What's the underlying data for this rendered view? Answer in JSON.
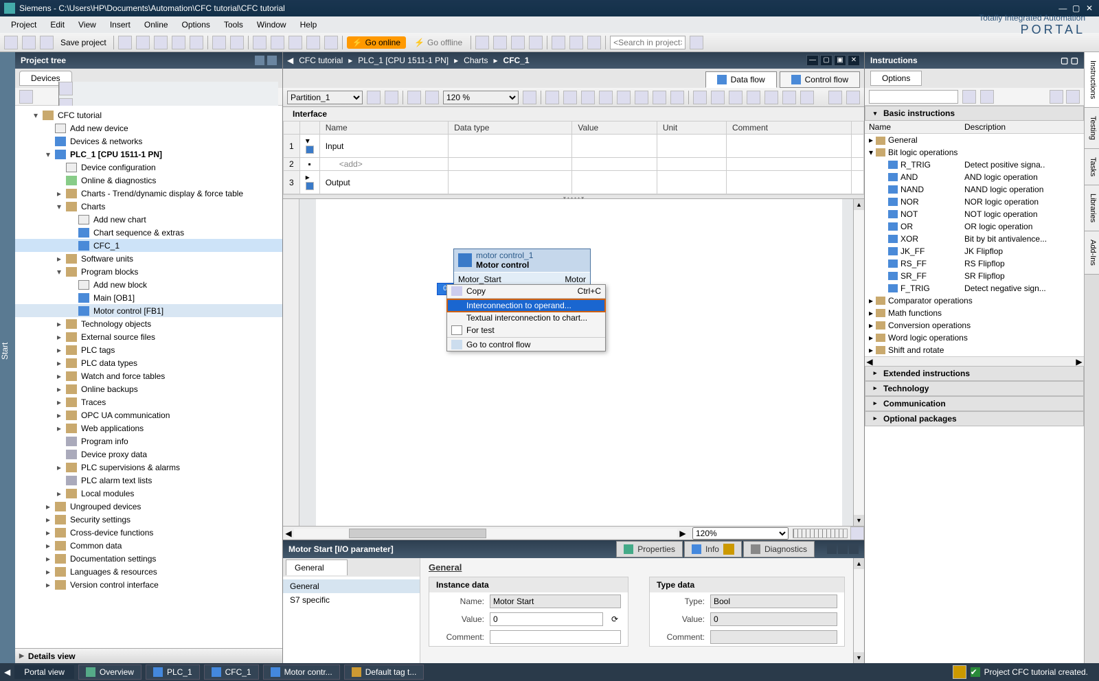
{
  "title": "Siemens  -  C:\\Users\\HP\\Documents\\Automation\\CFC tutorial\\CFC tutorial",
  "menubar": [
    "Project",
    "Edit",
    "View",
    "Insert",
    "Online",
    "Options",
    "Tools",
    "Window",
    "Help"
  ],
  "tia": {
    "line1": "Totally Integrated Automation",
    "line2": "PORTAL"
  },
  "toolbar": {
    "save": "Save project",
    "goOnline": "Go online",
    "goOffline": "Go offline",
    "searchPlaceholder": "<Search in project>"
  },
  "leftRail": "Start",
  "projectTree": {
    "title": "Project tree",
    "tab": "Devices",
    "details": "Details view",
    "nodes": [
      {
        "lvl": 1,
        "exp": "▾",
        "txt": "CFC tutorial",
        "ic": "ic"
      },
      {
        "lvl": 2,
        "exp": "",
        "txt": "Add new device",
        "ic": "ic white"
      },
      {
        "lvl": 2,
        "exp": "",
        "txt": "Devices & networks",
        "ic": "ic blue"
      },
      {
        "lvl": 2,
        "exp": "▾",
        "txt": "PLC_1 [CPU 1511-1 PN]",
        "ic": "ic blue",
        "bold": true
      },
      {
        "lvl": 3,
        "exp": "",
        "txt": "Device configuration",
        "ic": "ic white"
      },
      {
        "lvl": 3,
        "exp": "",
        "txt": "Online & diagnostics",
        "ic": "ic green"
      },
      {
        "lvl": 3,
        "exp": "▸",
        "txt": "Charts - Trend/dynamic display & force table",
        "ic": "ic"
      },
      {
        "lvl": 3,
        "exp": "▾",
        "txt": "Charts",
        "ic": "ic"
      },
      {
        "lvl": 4,
        "exp": "",
        "txt": "Add new chart",
        "ic": "ic white"
      },
      {
        "lvl": 4,
        "exp": "",
        "txt": "Chart sequence & extras",
        "ic": "ic blue"
      },
      {
        "lvl": 4,
        "exp": "",
        "txt": "CFC_1",
        "ic": "ic blue",
        "sel": true
      },
      {
        "lvl": 3,
        "exp": "▸",
        "txt": "Software units",
        "ic": "ic"
      },
      {
        "lvl": 3,
        "exp": "▾",
        "txt": "Program blocks",
        "ic": "ic"
      },
      {
        "lvl": 4,
        "exp": "",
        "txt": "Add new block",
        "ic": "ic white"
      },
      {
        "lvl": 4,
        "exp": "",
        "txt": "Main [OB1]",
        "ic": "ic blue"
      },
      {
        "lvl": 4,
        "exp": "",
        "txt": "Motor control [FB1]",
        "ic": "ic blue",
        "curr": true
      },
      {
        "lvl": 3,
        "exp": "▸",
        "txt": "Technology objects",
        "ic": "ic"
      },
      {
        "lvl": 3,
        "exp": "▸",
        "txt": "External source files",
        "ic": "ic"
      },
      {
        "lvl": 3,
        "exp": "▸",
        "txt": "PLC tags",
        "ic": "ic"
      },
      {
        "lvl": 3,
        "exp": "▸",
        "txt": "PLC data types",
        "ic": "ic"
      },
      {
        "lvl": 3,
        "exp": "▸",
        "txt": "Watch and force tables",
        "ic": "ic"
      },
      {
        "lvl": 3,
        "exp": "▸",
        "txt": "Online backups",
        "ic": "ic"
      },
      {
        "lvl": 3,
        "exp": "▸",
        "txt": "Traces",
        "ic": "ic"
      },
      {
        "lvl": 3,
        "exp": "▸",
        "txt": "OPC UA communication",
        "ic": "ic"
      },
      {
        "lvl": 3,
        "exp": "▸",
        "txt": "Web applications",
        "ic": "ic"
      },
      {
        "lvl": 3,
        "exp": "",
        "txt": "Program info",
        "ic": "ic grey"
      },
      {
        "lvl": 3,
        "exp": "",
        "txt": "Device proxy data",
        "ic": "ic grey"
      },
      {
        "lvl": 3,
        "exp": "▸",
        "txt": "PLC supervisions & alarms",
        "ic": "ic"
      },
      {
        "lvl": 3,
        "exp": "",
        "txt": "PLC alarm text lists",
        "ic": "ic grey"
      },
      {
        "lvl": 3,
        "exp": "▸",
        "txt": "Local modules",
        "ic": "ic"
      },
      {
        "lvl": 2,
        "exp": "▸",
        "txt": "Ungrouped devices",
        "ic": "ic"
      },
      {
        "lvl": 2,
        "exp": "▸",
        "txt": "Security settings",
        "ic": "ic"
      },
      {
        "lvl": 2,
        "exp": "▸",
        "txt": "Cross-device functions",
        "ic": "ic"
      },
      {
        "lvl": 2,
        "exp": "▸",
        "txt": "Common data",
        "ic": "ic"
      },
      {
        "lvl": 2,
        "exp": "▸",
        "txt": "Documentation settings",
        "ic": "ic"
      },
      {
        "lvl": 2,
        "exp": "▸",
        "txt": "Languages & resources",
        "ic": "ic"
      },
      {
        "lvl": 2,
        "exp": "▸",
        "txt": "Version control interface",
        "ic": "ic"
      }
    ]
  },
  "breadcrumb": [
    "CFC tutorial",
    "PLC_1 [CPU 1511-1 PN]",
    "Charts",
    "CFC_1"
  ],
  "flowTabs": {
    "data": "Data flow",
    "control": "Control flow"
  },
  "ctoolbar": {
    "partition": "Partition_1",
    "zoom": "120 %"
  },
  "interface": {
    "title": "Interface",
    "cols": [
      "",
      "Name",
      "Data type",
      "Value",
      "Unit",
      "Comment"
    ],
    "rows": [
      {
        "n": "1",
        "name": "Input",
        "kind": "hdr"
      },
      {
        "n": "2",
        "name": "<add>",
        "kind": "add"
      },
      {
        "n": "3",
        "name": "Output",
        "kind": "hdr"
      }
    ]
  },
  "block": {
    "instance": "motor control_1",
    "type": "Motor control",
    "port": "Motor_Start",
    "outPort": "Motor",
    "selPort": "0"
  },
  "ctx": {
    "copy": "Copy",
    "copyKey": "Ctrl+C",
    "interOp": "Interconnection to operand...",
    "interChart": "Textual interconnection to chart...",
    "forTest": "For test",
    "goCF": "Go to control flow"
  },
  "hzoom": "120%",
  "inspector": {
    "title": "Motor Start [I/O parameter]",
    "tabs": {
      "props": "Properties",
      "info": "Info",
      "diag": "Diagnostics"
    },
    "leftTab": "General",
    "leftItems": [
      "General",
      "S7 specific"
    ],
    "section": "General",
    "instance": {
      "title": "Instance data",
      "name": "Motor Start",
      "value": "0",
      "comment": "Comment:"
    },
    "type": {
      "title": "Type data",
      "type": "Bool",
      "value": "0",
      "comment": "Comment:"
    },
    "labels": {
      "name": "Name:",
      "value": "Value:",
      "type": "Type:"
    }
  },
  "right": {
    "title": "Instructions",
    "optsTab": "Options",
    "basic": "Basic instructions",
    "cols": {
      "name": "Name",
      "desc": "Description"
    },
    "cats": [
      {
        "txt": "General",
        "exp": "▸"
      },
      {
        "txt": "Bit logic operations",
        "exp": "▾",
        "items": [
          {
            "n": "R_TRIG",
            "d": "Detect positive signa.."
          },
          {
            "n": "AND",
            "d": "AND logic operation"
          },
          {
            "n": "NAND",
            "d": "NAND logic operation"
          },
          {
            "n": "NOR",
            "d": "NOR logic operation"
          },
          {
            "n": "NOT",
            "d": "NOT logic operation"
          },
          {
            "n": "OR",
            "d": "OR logic operation"
          },
          {
            "n": "XOR",
            "d": "Bit by bit antivalence..."
          },
          {
            "n": "JK_FF",
            "d": "JK Flipflop"
          },
          {
            "n": "RS_FF",
            "d": "RS Flipflop"
          },
          {
            "n": "SR_FF",
            "d": "SR Flipflop"
          },
          {
            "n": "F_TRIG",
            "d": "Detect negative sign..."
          }
        ]
      },
      {
        "txt": "Comparator operations",
        "exp": "▸"
      },
      {
        "txt": "Math functions",
        "exp": "▸"
      },
      {
        "txt": "Conversion operations",
        "exp": "▸"
      },
      {
        "txt": "Word logic operations",
        "exp": "▸"
      },
      {
        "txt": "Shift and rotate",
        "exp": "▸"
      }
    ],
    "others": [
      "Extended instructions",
      "Technology",
      "Communication",
      "Optional packages"
    ],
    "rail": [
      "Instructions",
      "Testing",
      "Tasks",
      "Libraries",
      "Add-Ins"
    ]
  },
  "status": {
    "portal": "Portal view",
    "chips": [
      "Overview",
      "PLC_1",
      "CFC_1",
      "Motor contr...",
      "Default tag t..."
    ],
    "msg": "Project CFC tutorial created."
  }
}
